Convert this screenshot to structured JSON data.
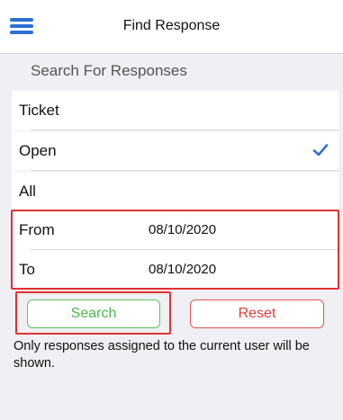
{
  "header": {
    "title": "Find Response",
    "menu_icon": "hamburger-menu-icon"
  },
  "search": {
    "section_label": "Search For Responses",
    "options": [
      {
        "label": "Ticket",
        "selected": false
      },
      {
        "label": "Open",
        "selected": true
      },
      {
        "label": "All",
        "selected": false
      }
    ],
    "from": {
      "label": "From",
      "value": "08/10/2020"
    },
    "to": {
      "label": "To",
      "value": "08/10/2020"
    }
  },
  "actions": {
    "search_label": "Search",
    "reset_label": "Reset"
  },
  "note": "Only responses assigned to the current user will be shown.",
  "colors": {
    "accent": "#2e6fd3",
    "search_button": "#4cba4c",
    "reset_button": "#e03c3c",
    "highlight_outline": "#e03131",
    "background": "#efeff4"
  }
}
